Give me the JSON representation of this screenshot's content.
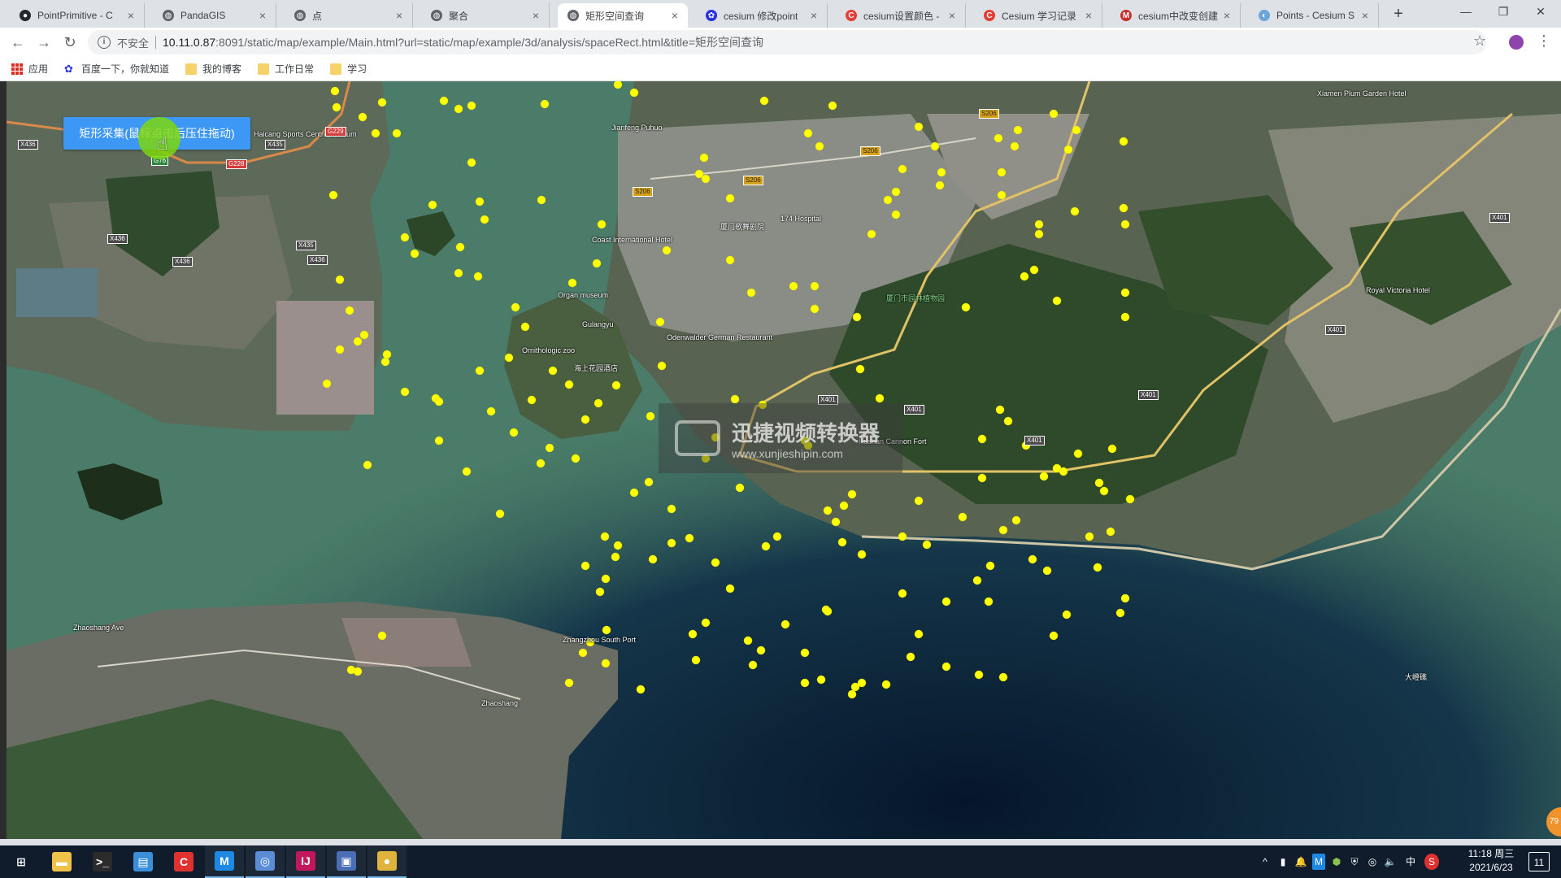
{
  "browser": {
    "tabs": [
      {
        "title": "PointPrimitive - C",
        "icon": "github-icon",
        "color": "#24292e"
      },
      {
        "title": "PandaGIS",
        "icon": "globe-icon",
        "color": "#5f6368"
      },
      {
        "title": "点",
        "icon": "globe-icon",
        "color": "#5f6368"
      },
      {
        "title": "聚合",
        "icon": "globe-icon",
        "color": "#5f6368"
      },
      {
        "title": "矩形空间查询",
        "icon": "globe-icon",
        "color": "#5f6368",
        "active": true
      },
      {
        "title": "cesium 修改point",
        "icon": "baidu-paw-icon",
        "color": "#2932e1"
      },
      {
        "title": "cesium设置颜色 - ",
        "icon": "csdn-icon",
        "color": "#e33e33"
      },
      {
        "title": "Cesium 学习记录",
        "icon": "csdn-icon",
        "color": "#e33e33"
      },
      {
        "title": "cesium中改变创建",
        "icon": "mu-icon",
        "color": "#c9302c"
      },
      {
        "title": "Points - Cesium S",
        "icon": "cesium-icon",
        "color": "#6ca6d9"
      }
    ],
    "new_tab": "+",
    "window_controls": {
      "minimize": "—",
      "restore": "❐",
      "close": "✕"
    }
  },
  "toolbar": {
    "back": "←",
    "forward": "→",
    "reload": "↻",
    "security_icon": "i",
    "security_text": "不安全",
    "url_host": "10.11.0.87",
    "url_rest": ":8091/static/map/example/Main.html?url=static/map/example/3d/analysis/spaceRect.html&title=矩形空间查询",
    "star": "☆",
    "menu": "⋮"
  },
  "bookmarks": [
    {
      "label": "应用",
      "icon": "apps-grid-icon"
    },
    {
      "label": "百度一下，你就知道",
      "icon": "baidu-paw-icon"
    },
    {
      "label": "我的博客",
      "icon": "folder-icon"
    },
    {
      "label": "工作日常",
      "icon": "folder-icon"
    },
    {
      "label": "学习",
      "icon": "folder-icon"
    }
  ],
  "map": {
    "collect_button": "矩形采集(鼠标点击后压住拖动)",
    "watermark": {
      "title": "迅捷视频转换器",
      "url": "www.xunjieshipin.com"
    },
    "badge": "79",
    "labels": [
      "Haicang Sports Centre Stadium",
      "Jianfeng Puhuo",
      "Coast International Hotel",
      "Organ museum",
      "Gulangyu",
      "Ornithologic zoo",
      "海上花园酒店",
      "Odenwalder German Restaurant",
      "Hushan Cannon Fort",
      "厦门市园林植物园",
      "174 Hospital",
      "厦门歌舞剧院",
      "Zhaoshang Ave",
      "Zhangzhou South Port",
      "Royal Victoria Hotel",
      "Xiamen Plum Garden Hotel",
      "Zhaoshang",
      "大嶝礁"
    ],
    "road_shields": [
      "G229",
      "X436",
      "G76",
      "X435",
      "G76",
      "G228",
      "X436",
      "X435",
      "X436",
      "X436",
      "S206",
      "S206",
      "S206",
      "S206",
      "X401",
      "X401",
      "X401",
      "X401",
      "X401",
      "X401"
    ]
  },
  "taskbar": {
    "apps": [
      {
        "name": "start",
        "glyph": "⊞",
        "color": "#ffffff"
      },
      {
        "name": "file-explorer",
        "glyph": "▬",
        "color": "#f0c24a"
      },
      {
        "name": "terminal",
        "glyph": ">_",
        "color": "#2b2b2b"
      },
      {
        "name": "notes",
        "glyph": "▤",
        "color": "#3b8fd9"
      },
      {
        "name": "app-red",
        "glyph": "C",
        "color": "#e03131"
      },
      {
        "name": "mail-m",
        "glyph": "M",
        "color": "#1e88e5"
      },
      {
        "name": "network",
        "glyph": "◎",
        "color": "#5b8dd6"
      },
      {
        "name": "intellij",
        "glyph": "IJ",
        "color": "#c2185b"
      },
      {
        "name": "display",
        "glyph": "▣",
        "color": "#4a6fb5"
      },
      {
        "name": "chrome",
        "glyph": "●",
        "color": "#e0b43c"
      }
    ],
    "tray": {
      "ime": "中",
      "speaker": "🔈",
      "time": "11:18 周三",
      "date": "2021/6/23",
      "notifications": "11"
    }
  }
}
